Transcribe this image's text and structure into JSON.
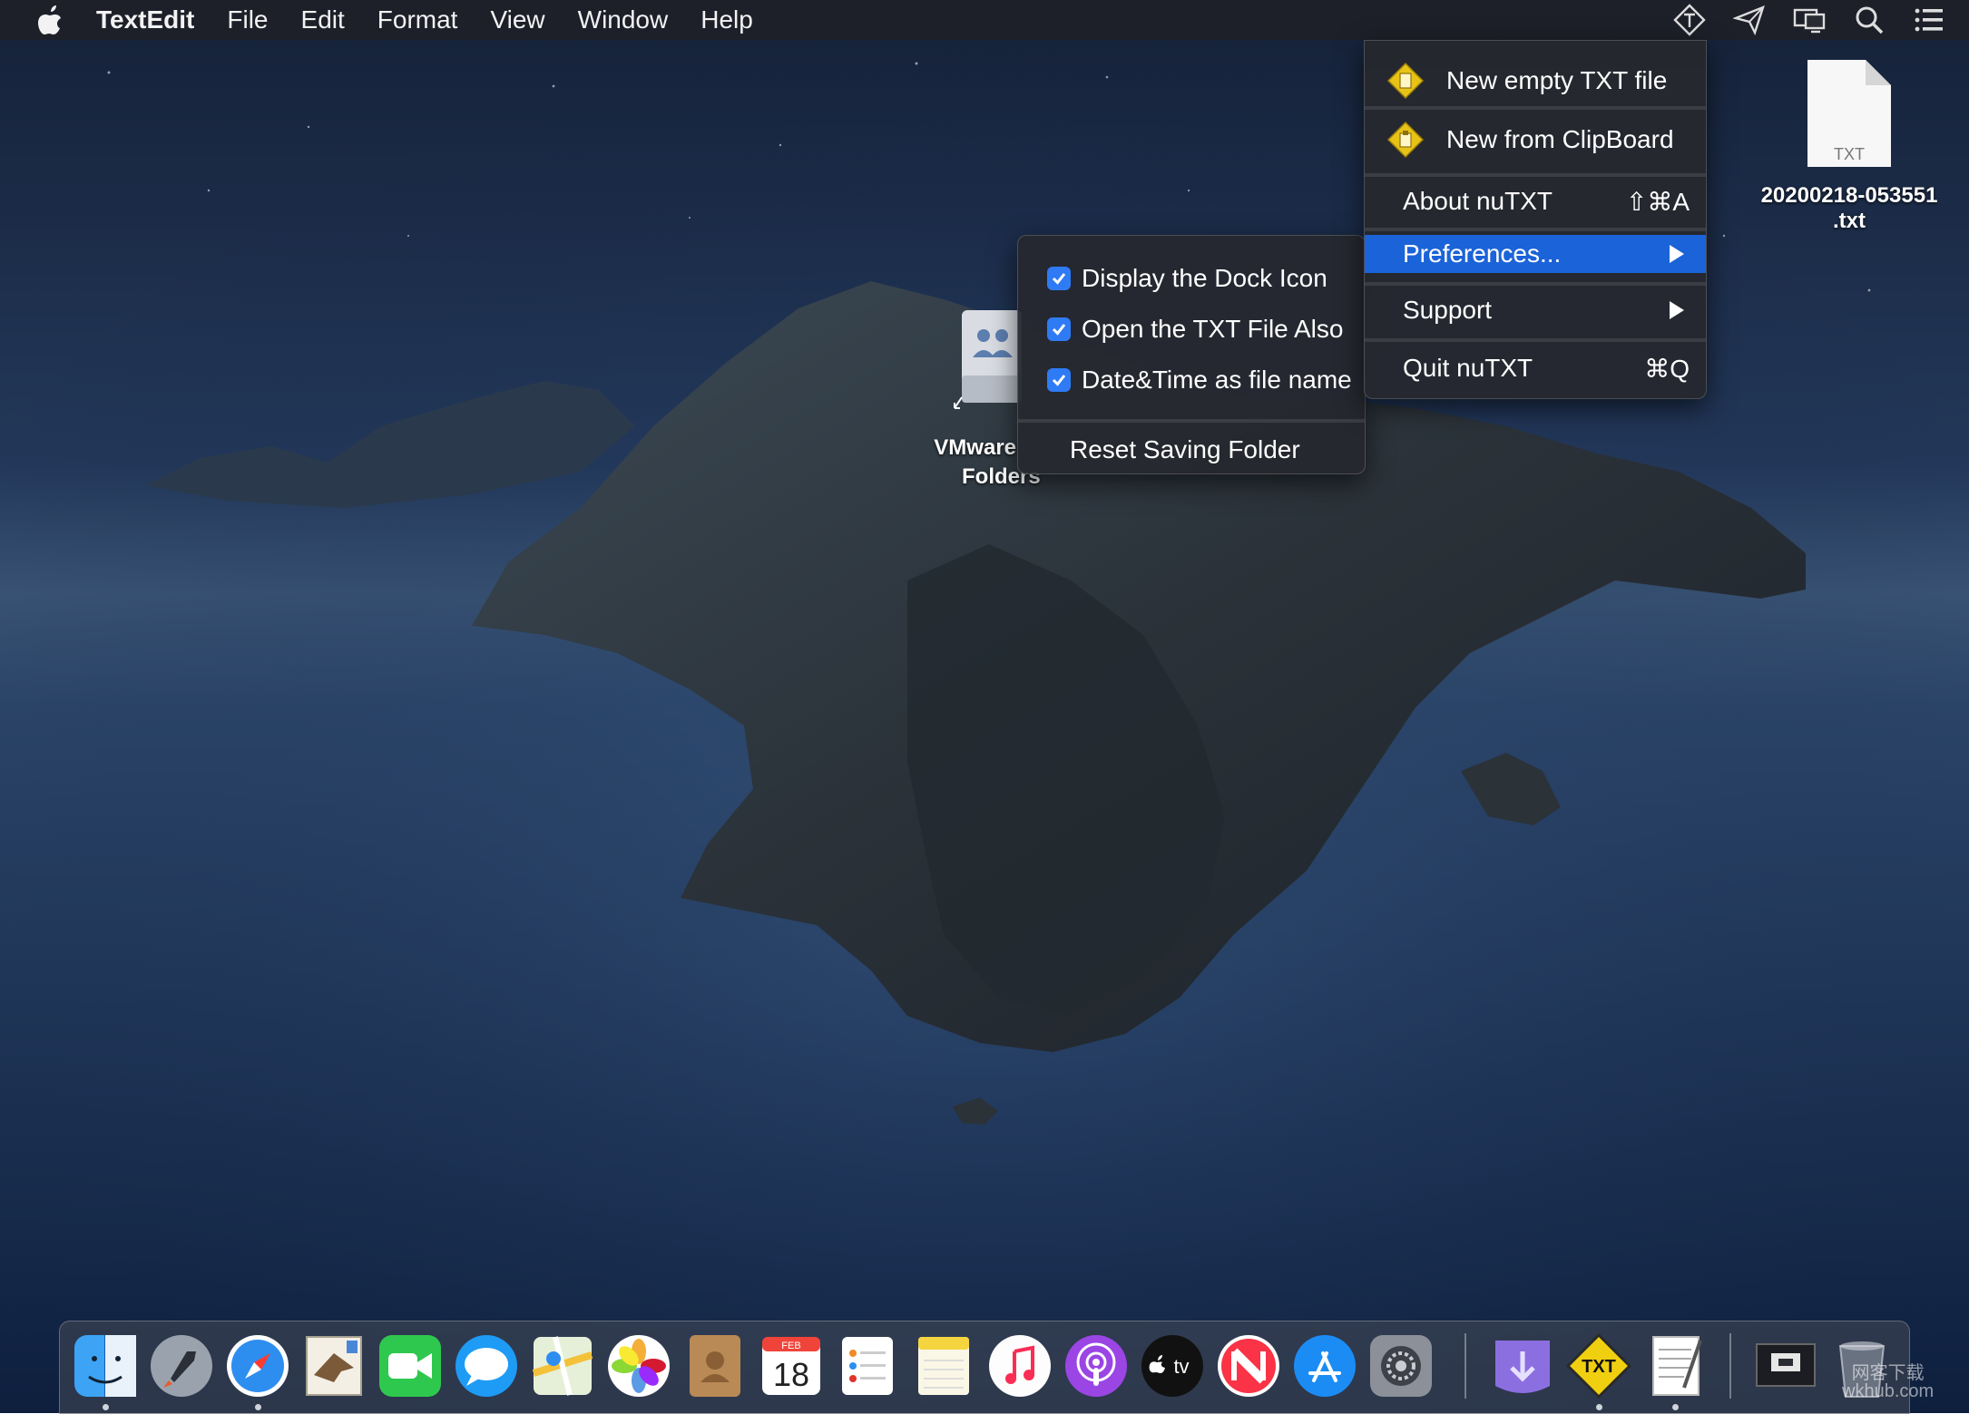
{
  "menubar": {
    "app_name": "TextEdit",
    "items": [
      "File",
      "Edit",
      "Format",
      "View",
      "Window",
      "Help"
    ],
    "status_icons": [
      "nutxt-icon",
      "paper-plane-icon",
      "display-icon",
      "spotlight-search-icon",
      "notification-center-icon"
    ]
  },
  "nutxt_menu": {
    "new_empty": "New empty TXT file",
    "new_clipboard": "New from ClipBoard",
    "about": "About nuTXT",
    "about_shortcut": "⇧⌘A",
    "preferences": "Preferences...",
    "support": "Support",
    "quit": "Quit nuTXT",
    "quit_shortcut": "⌘Q"
  },
  "preferences_submenu": {
    "items": [
      {
        "label": "Display the Dock Icon",
        "checked": true
      },
      {
        "label": "Open the TXT File Also",
        "checked": true
      },
      {
        "label": "Date&Time as file name",
        "checked": true
      }
    ],
    "reset": "Reset Saving Folder"
  },
  "desktop": {
    "txt_file_badge": "TXT",
    "txt_file_name_line1": "20200218-053551",
    "txt_file_name_line2": ".txt",
    "vmware_label_line1": "VMware",
    "vmware_label_line2": "Folders"
  },
  "dock": {
    "calendar_month": "FEB",
    "calendar_day": "18",
    "tv_label": "tv",
    "txt_badge": "TXT",
    "apps": [
      "Finder",
      "Launchpad",
      "Safari",
      "Mail",
      "FaceTime",
      "Messages",
      "Maps",
      "Photos",
      "Contacts",
      "Calendar",
      "Reminders",
      "Notes",
      "Music",
      "Podcasts",
      "Apple TV",
      "News",
      "App Store",
      "System Preferences",
      "Downloads",
      "nuTXT",
      "TextEdit",
      "Screenshot",
      "Trash"
    ]
  },
  "watermark": {
    "line1": "网客下载",
    "line2": "wkhub.com"
  }
}
